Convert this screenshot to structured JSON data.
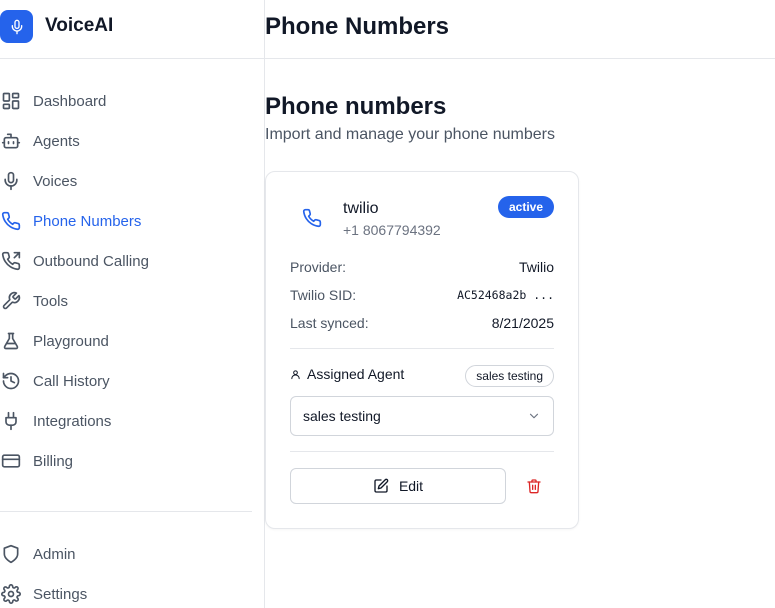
{
  "app": {
    "name": "VoiceAI",
    "logo_icon": "mic-icon",
    "accent": "#2563eb"
  },
  "sidebar": {
    "items": [
      {
        "label": "Dashboard",
        "icon": "dashboard-icon"
      },
      {
        "label": "Agents",
        "icon": "bot-icon"
      },
      {
        "label": "Voices",
        "icon": "mic-icon"
      },
      {
        "label": "Phone Numbers",
        "icon": "phone-icon",
        "active": true
      },
      {
        "label": "Outbound Calling",
        "icon": "phone-outgoing-icon"
      },
      {
        "label": "Tools",
        "icon": "wrench-icon"
      },
      {
        "label": "Playground",
        "icon": "flask-icon"
      },
      {
        "label": "Call History",
        "icon": "history-icon"
      },
      {
        "label": "Integrations",
        "icon": "plug-icon"
      },
      {
        "label": "Billing",
        "icon": "credit-card-icon"
      }
    ],
    "bottom_items": [
      {
        "label": "Admin",
        "icon": "shield-icon"
      },
      {
        "label": "Settings",
        "icon": "gear-icon"
      }
    ]
  },
  "header": {
    "title": "Phone Numbers"
  },
  "main": {
    "title": "Phone numbers",
    "subtitle": "Import and manage your phone numbers",
    "card": {
      "name": "twilio",
      "number": "+1 8067794392",
      "status": "active",
      "status_color": "#2563eb",
      "details": [
        {
          "key": "Provider:",
          "value": "Twilio"
        },
        {
          "key": "Twilio SID:",
          "value": "AC52468a2b ..."
        },
        {
          "key": "Last synced:",
          "value": "8/21/2025"
        }
      ],
      "assigned_agent_label": "Assigned Agent",
      "assigned_agent_badge": "sales testing",
      "agent_select_value": "sales testing",
      "edit_label": "Edit",
      "delete_color": "#dc2626"
    }
  }
}
